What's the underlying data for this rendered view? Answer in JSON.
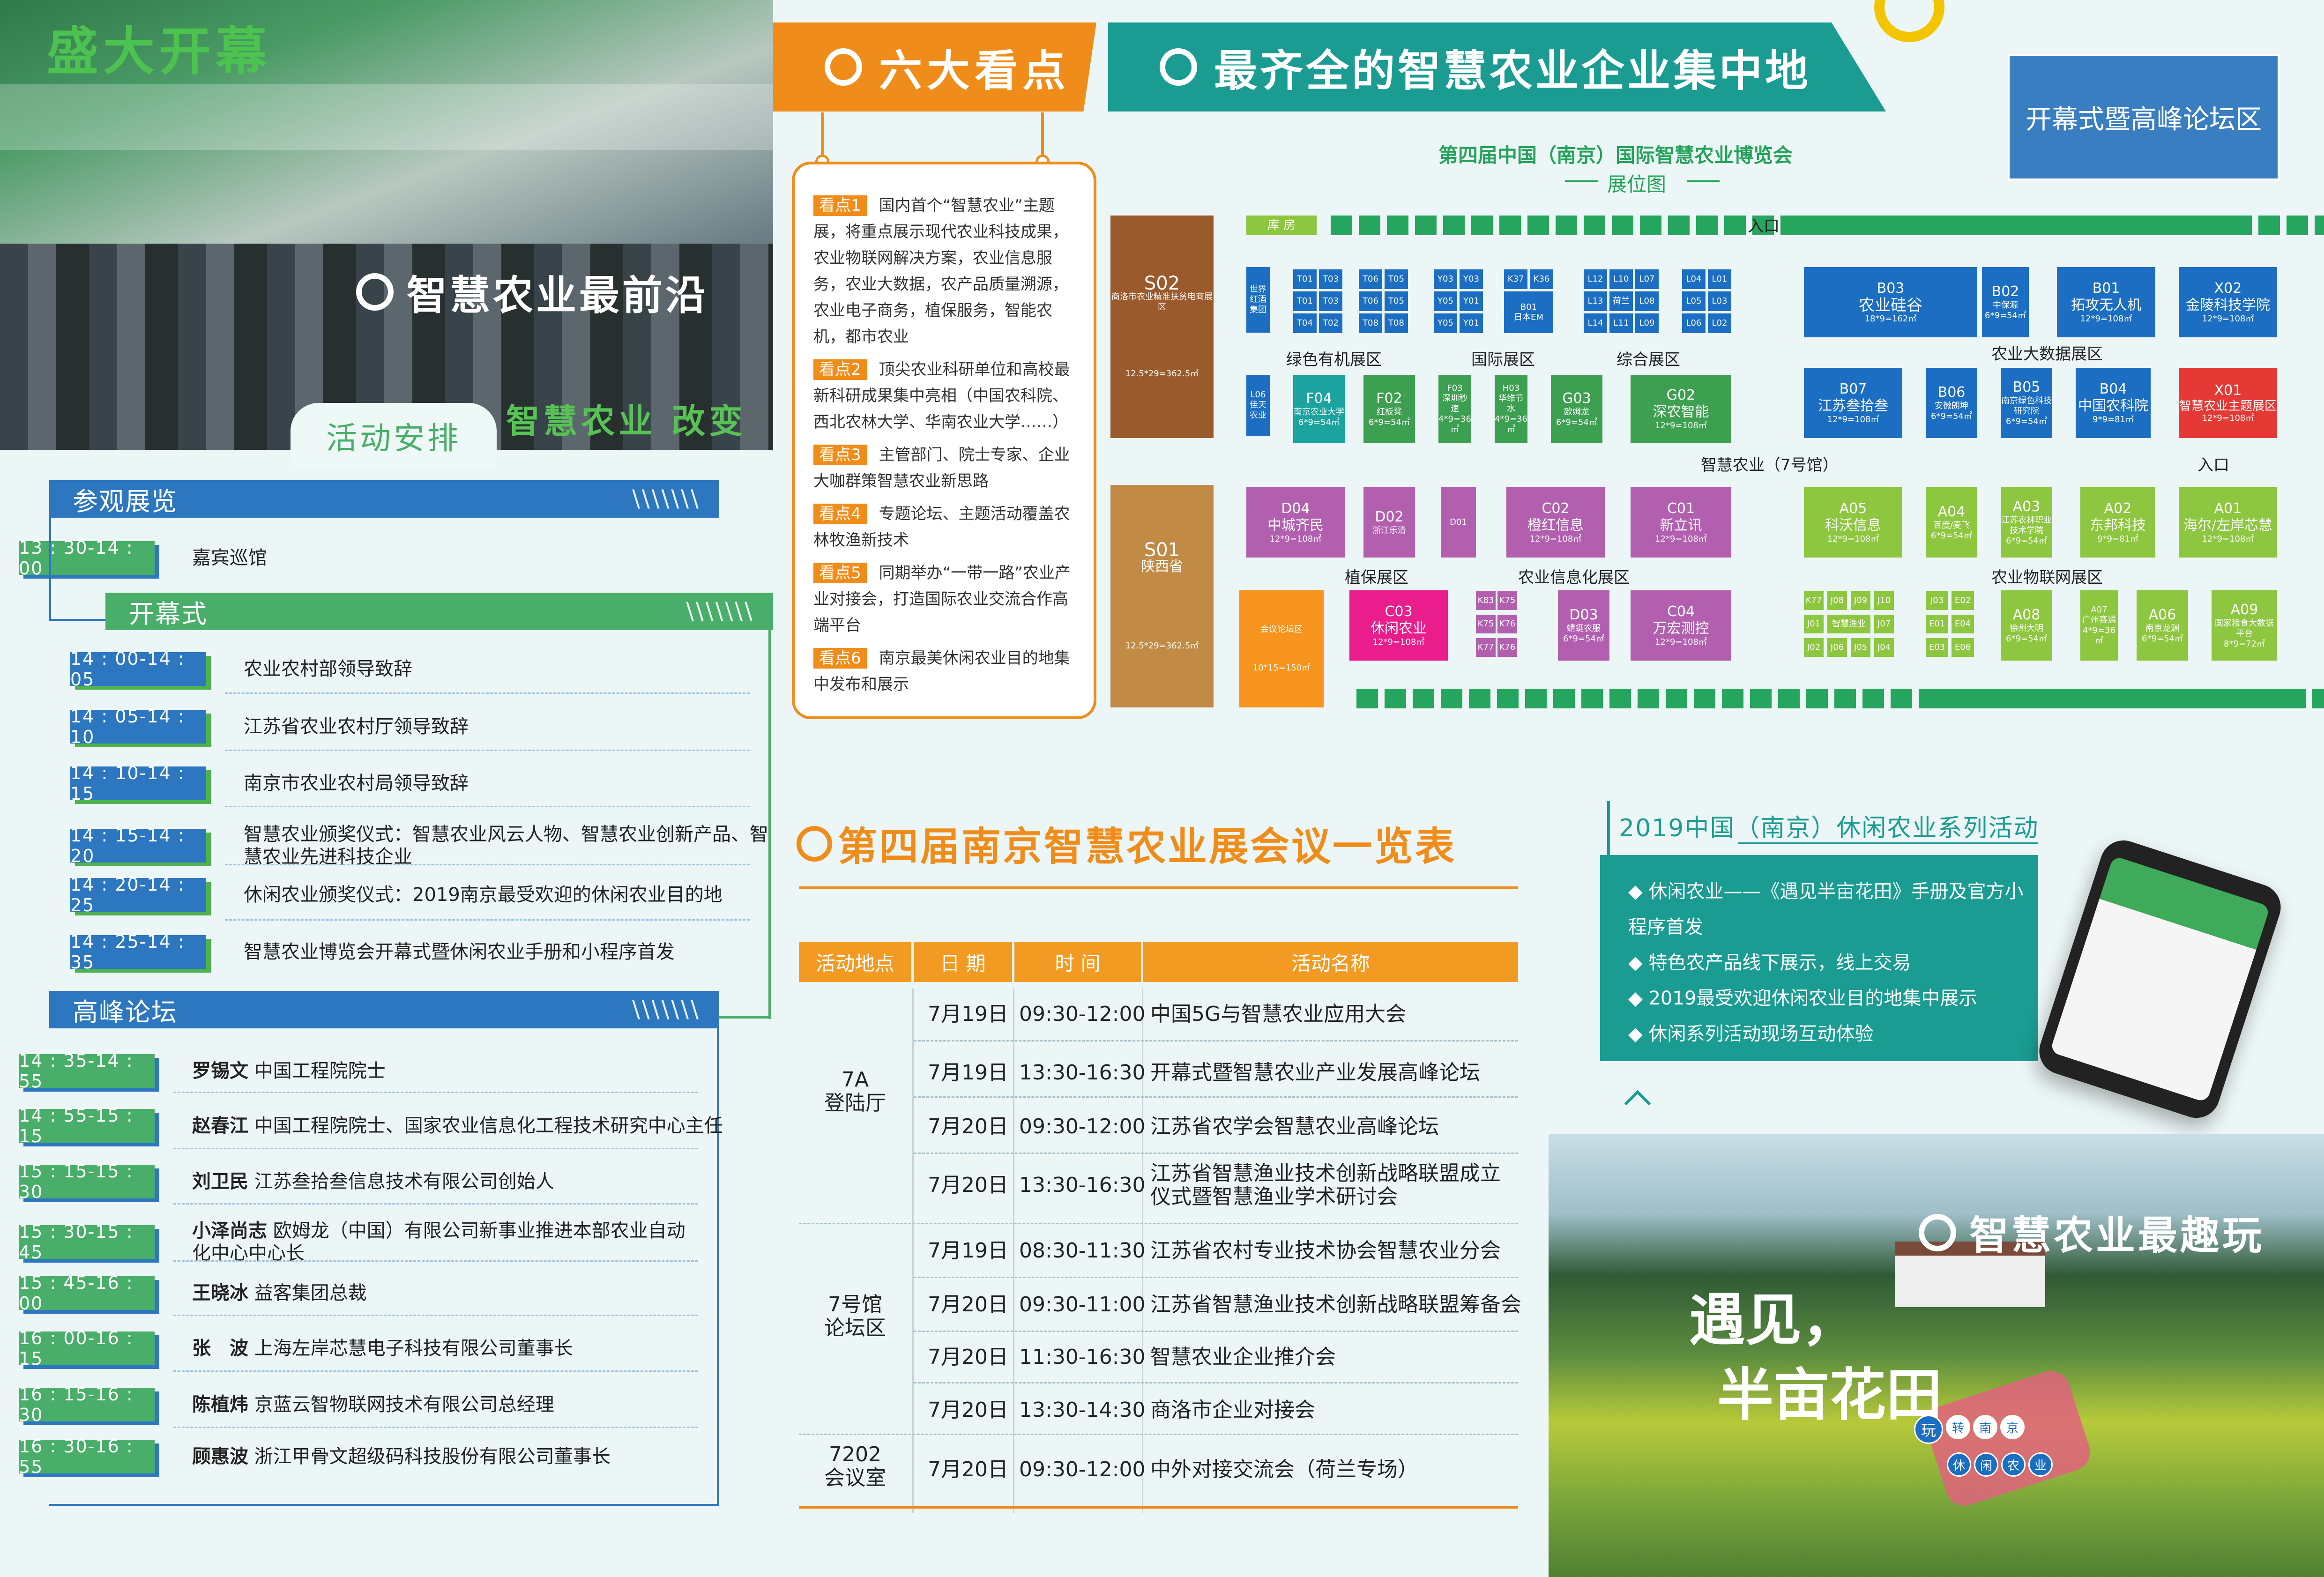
{
  "photo_top": {
    "banner": "盛大开幕",
    "caption": "智慧农业最前沿",
    "sub_banner": "智慧农业 改变"
  },
  "activity_tab": "活动安排",
  "sections": {
    "visit": {
      "title": "参观展览",
      "slashes": "\\\\\\\\\\\\\\",
      "rows": [
        {
          "time": "13 : 30-14 : 00",
          "text": "嘉宾巡馆"
        }
      ]
    },
    "opening": {
      "title": "开幕式",
      "slashes": "\\\\\\\\\\\\\\",
      "rows": [
        {
          "time": "14 : 00-14 : 05",
          "text": "农业农村部领导致辞"
        },
        {
          "time": "14 : 05-14 : 10",
          "text": "江苏省农业农村厅领导致辞"
        },
        {
          "time": "14 : 10-14 : 15",
          "text": "南京市农业农村局领导致辞"
        },
        {
          "time": "14 : 15-14 : 20",
          "text": "智慧农业颁奖仪式：智慧农业风云人物、智慧农业创新产品、智慧农业先进科技企业"
        },
        {
          "time": "14 : 20-14 : 25",
          "text": "休闲农业颁奖仪式：2019南京最受欢迎的休闲农业目的地"
        },
        {
          "time": "14 : 25-14 : 35",
          "text": "智慧农业博览会开幕式暨休闲农业手册和小程序首发"
        }
      ]
    },
    "forum": {
      "title": "高峰论坛",
      "slashes": "\\\\\\\\\\\\\\",
      "rows": [
        {
          "time": "14 : 35-14 : 55",
          "name": "罗锡文",
          "text": "中国工程院院士"
        },
        {
          "time": "14 : 55-15 : 15",
          "name": "赵春江",
          "text": "中国工程院院士、国家农业信息化工程技术研究中心主任"
        },
        {
          "time": "15 : 15-15 : 30",
          "name": "刘卫民",
          "text": "江苏叁拾叁信息技术有限公司创始人"
        },
        {
          "time": "15 : 30-15 : 45",
          "name": "小泽尚志",
          "text": "欧姆龙（中国）有限公司新事业推进本部农业自动化中心中心长"
        },
        {
          "time": "15 : 45-16 : 00",
          "name": "王晓冰",
          "text": "益客集团总裁"
        },
        {
          "time": "16 : 00-16 : 15",
          "name": "张　波",
          "text": "上海左岸芯慧电子科技有限公司董事长"
        },
        {
          "time": "16 : 15-16 : 30",
          "name": "陈植炜",
          "text": "京蓝云智物联网技术有限公司总经理"
        },
        {
          "time": "16 : 30-16 : 55",
          "name": "顾惠波",
          "text": "浙江甲骨文超级码科技股份有限公司董事长"
        }
      ]
    }
  },
  "six_highlights": {
    "title": "六大看点",
    "items": [
      {
        "tag": "看点1",
        "text": "国内首个“智慧农业”主题展，将重点展示现代农业科技成果，农业物联网解决方案，农业信息服务，农业大数据，农产品质量溯源，农业电子商务，植保服务，智能农机，都市农业"
      },
      {
        "tag": "看点2",
        "text": "顶尖农业科研单位和高校最新科研成果集中亮相（中国农科院、西北农林大学、华南农业大学……）"
      },
      {
        "tag": "看点3",
        "text": "主管部门、院士专家、企业大咖群策智慧农业新思路"
      },
      {
        "tag": "看点4",
        "text": "专题论坛、主题活动覆盖农林牧渔新技术"
      },
      {
        "tag": "看点5",
        "text": "同期举办“一带一路”农业产业对接会，打造国际农业交流合作高端平台"
      },
      {
        "tag": "看点6",
        "text": "南京最美休闲农业目的地集中发布和展示"
      }
    ]
  },
  "enterprise_title": "最齐全的智慧农业企业集中地",
  "forum_area": "开幕式暨高峰论坛区",
  "map": {
    "title": "第四届中国（南京）国际智慧农业博览会",
    "subtitle": "展位图",
    "entrance": "入口",
    "warehouse": "库 房",
    "hall": "智慧农业（7号馆）",
    "zones": [
      "绿色有机展区",
      "国际展区",
      "综合展区",
      "农业大数据展区",
      "植保展区",
      "农业信息化展区",
      "农业物联网展区"
    ],
    "booths": {
      "S02": {
        "id": "S02",
        "name": "商洛市农业精准扶贫电商展区",
        "size": "12.5*29=362.5㎡"
      },
      "S01": {
        "id": "S01",
        "name": "陕西省",
        "size": "12.5*29=362.5㎡"
      },
      "forum_small": {
        "name": "会议论坛区",
        "size": "10*15=150㎡"
      },
      "B03": {
        "id": "B03",
        "name": "农业硅谷",
        "size": "18*9=162㎡"
      },
      "B02": {
        "id": "B02",
        "name": "中保源",
        "size": "6*9=54㎡"
      },
      "B01": {
        "id": "B01",
        "name": "拓攻无人机",
        "size": "12*9=108㎡"
      },
      "X02": {
        "id": "X02",
        "name": "金陵科技学院",
        "size": "12*9=108㎡"
      },
      "B07": {
        "id": "B07",
        "name": "江苏叁拾叁",
        "size": "12*9=108㎡"
      },
      "B06": {
        "id": "B06",
        "name": "安徽朗坤",
        "size": "6*9=54㎡"
      },
      "B05": {
        "id": "B05",
        "name": "南京绿色科技研究院",
        "size": "6*9=54㎡"
      },
      "B04": {
        "id": "B04",
        "name": "中国农科院",
        "size": "9*9=81㎡"
      },
      "X01": {
        "id": "X01",
        "name": "智慧农业主题展区",
        "size": "12*9=108㎡"
      },
      "F04": {
        "id": "F04",
        "name": "南京农业大学",
        "size": "6*9=54㎡"
      },
      "F02": {
        "id": "F02",
        "name": "红板凳",
        "size": "6*9=54㎡"
      },
      "F03": {
        "id": "F03",
        "name": "深圳秒速",
        "size": "4*9=36㎡"
      },
      "H03": {
        "id": "H03",
        "name": "华维节水",
        "size": "4*9=36㎡"
      },
      "G03": {
        "id": "G03",
        "name": "欧姆龙",
        "size": "6*9=54㎡"
      },
      "G02": {
        "id": "G02",
        "name": "深农智能",
        "size": "12*9=108㎡"
      },
      "D04": {
        "id": "D04",
        "name": "中城齐民",
        "size": "12*9=108㎡"
      },
      "D02": {
        "id": "D02",
        "name": "浙江乐清",
        "size": ""
      },
      "D01": {
        "id": "D01",
        "name": "",
        "size": ""
      },
      "C02": {
        "id": "C02",
        "name": "橙红信息",
        "size": "12*9=108㎡"
      },
      "C01": {
        "id": "C01",
        "name": "新立讯",
        "size": "12*9=108㎡"
      },
      "C03": {
        "id": "C03",
        "name": "休闲农业",
        "size": "12*9=108㎡"
      },
      "D03": {
        "id": "D03",
        "name": "蜻蜓农服",
        "size": "6*9=54㎡"
      },
      "C04": {
        "id": "C04",
        "name": "万宏测控",
        "size": "12*9=108㎡"
      },
      "A05": {
        "id": "A05",
        "name": "科沃信息",
        "size": "12*9=108㎡"
      },
      "A04": {
        "id": "A04",
        "name": "百度/麦飞",
        "size": "6*9=54㎡"
      },
      "A03": {
        "id": "A03",
        "name": "江苏农林职业技术学院",
        "size": "6*9=54㎡"
      },
      "A02": {
        "id": "A02",
        "name": "东邦科技",
        "size": "9*9=81㎡"
      },
      "A01": {
        "id": "A01",
        "name": "海尔/左岸芯慧",
        "size": "12*9=108㎡"
      },
      "A08": {
        "id": "A08",
        "name": "徐州大明",
        "size": "6*9=54㎡"
      },
      "A07": {
        "id": "A07",
        "name": "广州赛通",
        "size": "4*9=36㎡"
      },
      "A06": {
        "id": "A06",
        "name": "南京龙渊",
        "size": "6*9=54㎡"
      },
      "A09": {
        "id": "A09",
        "name": "国家粮食大数据平台",
        "size": "8*9=72㎡"
      }
    },
    "small_booths": [
      "T01",
      "T03",
      "T06",
      "T05",
      "T01",
      "T03",
      "T06",
      "T05",
      "T04",
      "T02",
      "T08",
      "T08",
      "Y03",
      "Y03",
      "Y05",
      "Y01",
      "Y05",
      "Y01",
      "K37",
      "K36",
      "B01",
      "L12",
      "L10",
      "L07",
      "L13",
      "L08",
      "L14",
      "L11",
      "L09",
      "L04",
      "L01",
      "L05",
      "L03",
      "L06",
      "L02",
      "K83",
      "K75",
      "K75",
      "K76",
      "K77",
      "K76",
      "K77",
      "J08",
      "J09",
      "J10",
      "J01",
      "J07",
      "J02",
      "J06",
      "J05",
      "J04",
      "J03",
      "E02",
      "E01",
      "E04",
      "E03",
      "E06",
      "E05"
    ],
    "small_booth_names": {
      "K83": "佳天农业",
      "B01": "日本EM",
      "L13": "荷兰",
      "J_wisdom": "智慧渔业",
      "left_block": "世界红酒集团"
    }
  },
  "meetings": {
    "title": "第四届南京智慧农业展会议一览表",
    "headers": [
      "活动地点",
      "日 期",
      "时 间",
      "活动名称"
    ],
    "venues": [
      "7A\n登陆厅",
      "7号馆\n论坛区",
      "7202\n会议室"
    ],
    "rows": [
      {
        "date": "7月19日",
        "time": "09:30-12:00",
        "name": "中国5G与智慧农业应用大会"
      },
      {
        "date": "7月19日",
        "time": "13:30-16:30",
        "name": "开幕式暨智慧农业产业发展高峰论坛"
      },
      {
        "date": "7月20日",
        "time": "09:30-12:00",
        "name": "江苏省农学会智慧农业高峰论坛"
      },
      {
        "date": "7月20日",
        "time": "13:30-16:30",
        "name": "江苏省智慧渔业技术创新战略联盟成立仪式暨智慧渔业学术研讨会"
      },
      {
        "date": "7月19日",
        "time": "08:30-11:30",
        "name": "江苏省农村专业技术协会智慧农业分会"
      },
      {
        "date": "7月20日",
        "time": "09:30-11:00",
        "name": "江苏省智慧渔业技术创新战略联盟筹备会"
      },
      {
        "date": "7月20日",
        "time": "11:30-16:30",
        "name": "智慧农业企业推介会"
      },
      {
        "date": "7月20日",
        "time": "13:30-14:30",
        "name": "商洛市企业对接会"
      },
      {
        "date": "7月20日",
        "time": "09:30-12:00",
        "name": "中外对接交流会（荷兰专场）"
      }
    ]
  },
  "leisure": {
    "title": "2019中国（南京）休闲农业系列活动",
    "items": [
      "休闲农业——《遇见半亩花田》手册及官方小程序首发",
      "特色农产品线下展示，线上交易",
      "2019最受欢迎休闲农业目的地集中展示",
      "休闲系列活动现场互动体验"
    ]
  },
  "landscape": {
    "caption": "智慧农业最趣玩",
    "slogan1": "遇见，",
    "slogan2": "半亩花田",
    "circles1": [
      "玩",
      "转",
      "南",
      "京"
    ],
    "circles2": [
      "休",
      "闲",
      "农",
      "业"
    ]
  },
  "colors": {
    "orange": "#f08c19",
    "teal": "#1a9c92",
    "blue": "#2d77c0",
    "green": "#49ae6a"
  }
}
